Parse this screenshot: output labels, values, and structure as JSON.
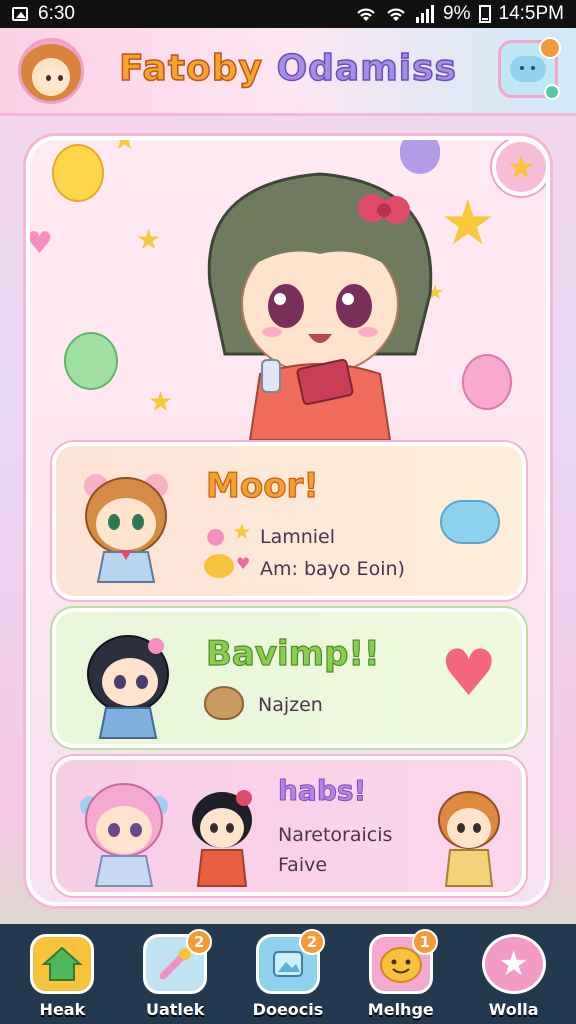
{
  "status_bar": {
    "time_left": "6:30",
    "battery": "9%",
    "time_right": "14:5PM"
  },
  "header": {
    "title_part1": "Fatoby",
    "title_part2": "Odamiss"
  },
  "cards": [
    {
      "title": "Moor!",
      "lines": [
        "Lamniel",
        "Am: bayo Eoin)"
      ]
    },
    {
      "title": "Bavimp!!",
      "lines": [
        "Najzen"
      ]
    },
    {
      "title": "habs!",
      "lines": [
        "Naretoraicis",
        "Faive"
      ]
    }
  ],
  "nav": [
    {
      "label": "Heak",
      "badge": ""
    },
    {
      "label": "Uatlek",
      "badge": "2"
    },
    {
      "label": "Doeocis",
      "badge": "2"
    },
    {
      "label": "Melhge",
      "badge": "1"
    },
    {
      "label": "Wolla",
      "badge": ""
    }
  ],
  "colors": {
    "accent_pink": "#f6b6d5",
    "nav_bg": "#23394f",
    "title_orange": "#f6a52b",
    "title_purple": "#a58ee6"
  },
  "icons": [
    "image-icon",
    "wifi-icon",
    "signal-icon",
    "battery-icon",
    "cloud-face-icon",
    "star-icon",
    "heart-icon",
    "home-icon",
    "wand-icon",
    "picture-icon",
    "smile-icon",
    "flower-star-icon"
  ]
}
